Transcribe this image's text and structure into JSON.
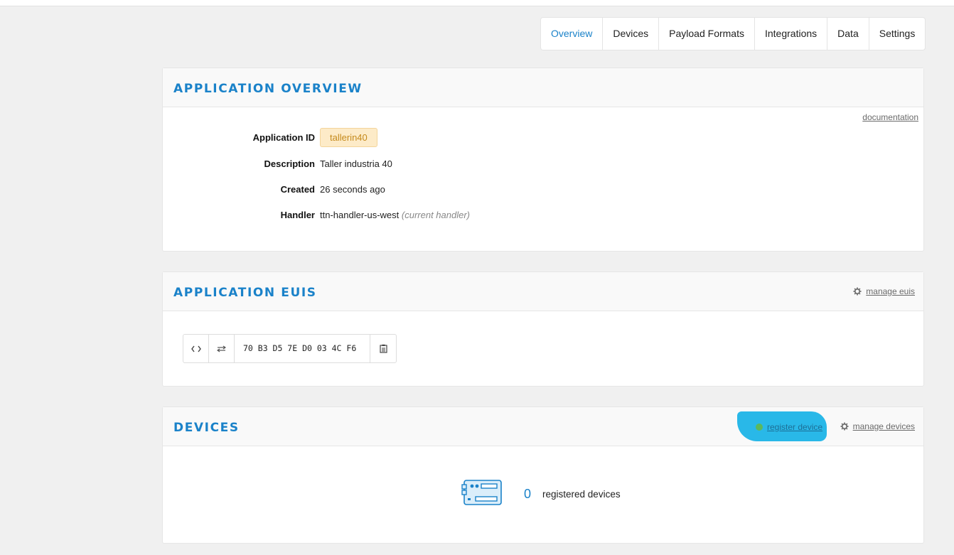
{
  "tabs": [
    {
      "label": "Overview",
      "active": true
    },
    {
      "label": "Devices"
    },
    {
      "label": "Payload Formats"
    },
    {
      "label": "Integrations"
    },
    {
      "label": "Data"
    },
    {
      "label": "Settings"
    }
  ],
  "overview": {
    "title": "APPLICATION OVERVIEW",
    "documentation_link": "documentation",
    "fields": {
      "app_id_label": "Application ID",
      "app_id_value": "tallerin40",
      "description_label": "Description",
      "description_value": "Taller industria 40",
      "created_label": "Created",
      "created_value": "26 seconds ago",
      "handler_label": "Handler",
      "handler_value": "ttn-handler-us-west",
      "handler_note": "(current handler)"
    }
  },
  "euis": {
    "title": "APPLICATION EUIS",
    "manage_link": "manage euis",
    "eui_value": "70 B3 D5 7E D0 03 4C F6",
    "icons": [
      "code-toggle-icon",
      "swap-byte-order-icon",
      "clipboard-icon"
    ]
  },
  "devices": {
    "title": "DEVICES",
    "register_link": "register device",
    "manage_link": "manage devices",
    "count": "0",
    "count_text": "registered devices"
  },
  "colors": {
    "accent": "#1a82c9",
    "badge_bg": "#fdebc8",
    "badge_text": "#c58a1c",
    "highlight_scribble": "#29b8e8",
    "add_green": "#5cb85c"
  }
}
